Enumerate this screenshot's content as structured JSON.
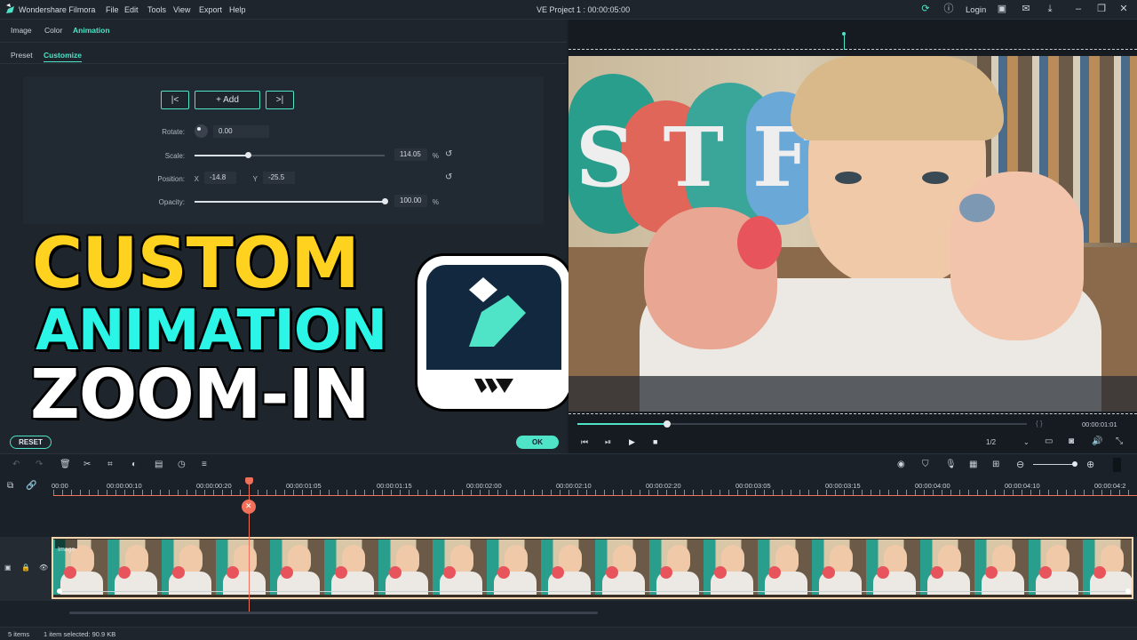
{
  "app": {
    "title": "Wondershare Filmora",
    "project": "VE Project 1 : 00:00:05:00",
    "login": "Login"
  },
  "menu": [
    "File",
    "Edit",
    "Tools",
    "View",
    "Export",
    "Help"
  ],
  "tabs": [
    "Image",
    "Color",
    "Animation"
  ],
  "subtabs": [
    "Preset",
    "Customize"
  ],
  "keyframe": {
    "add_label": "Add",
    "rotate_label": "Rotate:",
    "rotate_value": "0.00",
    "scale_label": "Scale:",
    "scale_value": "114.05",
    "scale_unit": "%",
    "scale_level": 0.28,
    "position_label": "Position:",
    "x_label": "X",
    "x_value": "-14.8",
    "y_label": "Y",
    "y_value": "-25.5",
    "opacity_label": "Opacity:",
    "opacity_value": "100.00",
    "opacity_unit": "%",
    "opacity_level": 1.0
  },
  "overlay": {
    "line1": "CUSTOM",
    "line2": "ANIMATION",
    "line3": "ZOOM-IN"
  },
  "buttons": {
    "reset": "RESET",
    "ok": "OK"
  },
  "preview": {
    "time": "00:00:01:01",
    "quality": "1/2",
    "braces": "{   }",
    "progress": 0.2
  },
  "ruler": [
    "00:00",
    "00:00:00:10",
    "00:00:00:20",
    "00:00:01:05",
    "00:00:01:15",
    "00:00:02:00",
    "00:00:02:10",
    "00:00:02:20",
    "00:00:03:05",
    "00:00:03:15",
    "00:00:04:00",
    "00:00:04:10",
    "00:00:04:2"
  ],
  "clip": {
    "label": "Image"
  },
  "status": {
    "items": "5 items",
    "selected": "1 item selected: 90.9 KB"
  },
  "colors": {
    "accent": "#4fe3c8",
    "yellow": "#ffd21f",
    "cyan": "#2af5e6",
    "playhead": "#f0705a"
  }
}
